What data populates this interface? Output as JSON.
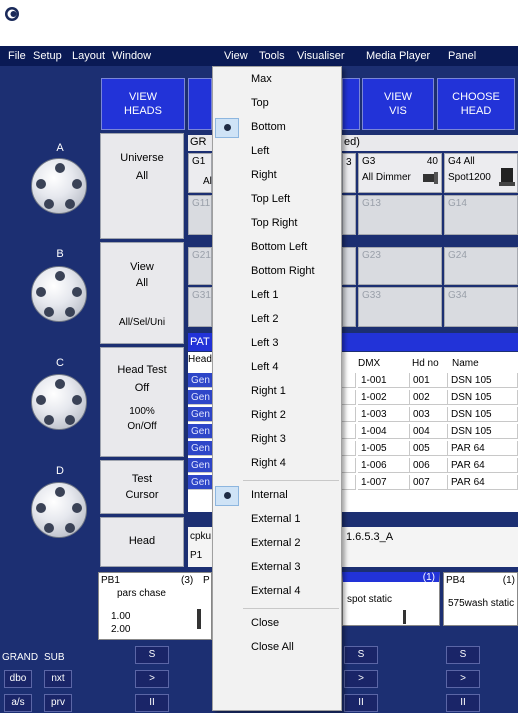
{
  "menubar": {
    "items": [
      "File",
      "Setup",
      "Layout",
      "Window",
      "View",
      "Tools",
      "Visualiser",
      "Media Player",
      "Panel"
    ]
  },
  "knobs": [
    "A",
    "B",
    "C",
    "D"
  ],
  "top_buttons": {
    "view_heads": "VIEW\nHEADS",
    "view_vis": "VIEW\nVIS",
    "choose_head": "CHOOSE\nHEAD"
  },
  "side_buttons": {
    "universe": {
      "title": "Universe",
      "value": "All"
    },
    "view": {
      "title": "View",
      "value": "All",
      "footer": "All/Sel/Uni"
    },
    "head_test": {
      "title": "Head Test",
      "value": "Off",
      "level": "100%",
      "footer": "On/Off"
    },
    "test": {
      "title": "Test",
      "value": "Cursor"
    },
    "head": {
      "title": "Head"
    }
  },
  "groups": {
    "title_prefix": "GR",
    "title_suffix": "ed)",
    "g1": "G1",
    "g1_sub": "Al",
    "g3": "G3",
    "g3_num": "40",
    "g3_sub": "All Dimmer",
    "g3_num2": "3",
    "g4": "G4 All",
    "g4_sub": "Spot1200",
    "g11": "G11",
    "g13": "G13",
    "g14": "G14",
    "g21": "G21",
    "g23": "G23",
    "g24": "G24",
    "g31": "G31",
    "g33": "G33",
    "g34": "G34"
  },
  "patch": {
    "title": "PAT",
    "head_col": "Head",
    "columns": [
      "DMX",
      "Hd no",
      "Name"
    ],
    "rows": [
      {
        "gen": "Gen",
        "dmx": "1-001",
        "hd": "001",
        "name": "DSN 105"
      },
      {
        "gen": "Gen",
        "dmx": "1-002",
        "hd": "002",
        "name": "DSN 105"
      },
      {
        "gen": "Gen",
        "dmx": "1-003",
        "hd": "003",
        "name": "DSN 105"
      },
      {
        "gen": "Gen",
        "dmx": "1-004",
        "hd": "004",
        "name": "DSN 105"
      },
      {
        "gen": "Gen",
        "dmx": "1-005",
        "hd": "005",
        "name": "PAR 64"
      },
      {
        "gen": "Gen",
        "dmx": "1-006",
        "hd": "006",
        "name": "PAR 64"
      },
      {
        "gen": "Gen",
        "dmx": "1-007",
        "hd": "007",
        "name": "PAR 64"
      }
    ]
  },
  "status": {
    "line1": "cpku",
    "line2": "P1",
    "version": "1.6.5.3_A"
  },
  "playbacks": [
    {
      "id": "PB1",
      "count": "(3)",
      "name": "pars chase",
      "v1": "1.00",
      "v2": "2.00",
      "extra": "P"
    },
    {
      "id": "",
      "count": "(1)",
      "name": "spot static"
    },
    {
      "id": "PB4",
      "count": "(1)",
      "name": "575wash static"
    }
  ],
  "bottom": {
    "grand": "GRAND",
    "sub": "SUB",
    "row1": [
      "dbo",
      "nxt"
    ],
    "row2": [
      "a/s",
      "prv"
    ],
    "s": "S",
    "next": ">",
    "pause": "II"
  },
  "view_menu": {
    "items": [
      {
        "label": "Max",
        "checked": false
      },
      {
        "label": "Top",
        "checked": false
      },
      {
        "label": "Bottom",
        "checked": true
      },
      {
        "label": "Left",
        "checked": false
      },
      {
        "label": "Right",
        "checked": false
      },
      {
        "label": "Top Left",
        "checked": false
      },
      {
        "label": "Top Right",
        "checked": false
      },
      {
        "label": "Bottom Left",
        "checked": false
      },
      {
        "label": "Bottom Right",
        "checked": false
      },
      {
        "label": "Left 1",
        "checked": false
      },
      {
        "label": "Left 2",
        "checked": false
      },
      {
        "label": "Left 3",
        "checked": false
      },
      {
        "label": "Left 4",
        "checked": false
      },
      {
        "label": "Right 1",
        "checked": false
      },
      {
        "label": "Right 2",
        "checked": false
      },
      {
        "label": "Right 3",
        "checked": false
      },
      {
        "label": "Right 4",
        "checked": false
      },
      {
        "label": "Internal",
        "checked": true
      },
      {
        "label": "External 1",
        "checked": false
      },
      {
        "label": "External 2",
        "checked": false
      },
      {
        "label": "External 3",
        "checked": false
      },
      {
        "label": "External 4",
        "checked": false
      },
      {
        "label": "Close",
        "checked": false
      },
      {
        "label": "Close All",
        "checked": false
      }
    ]
  }
}
